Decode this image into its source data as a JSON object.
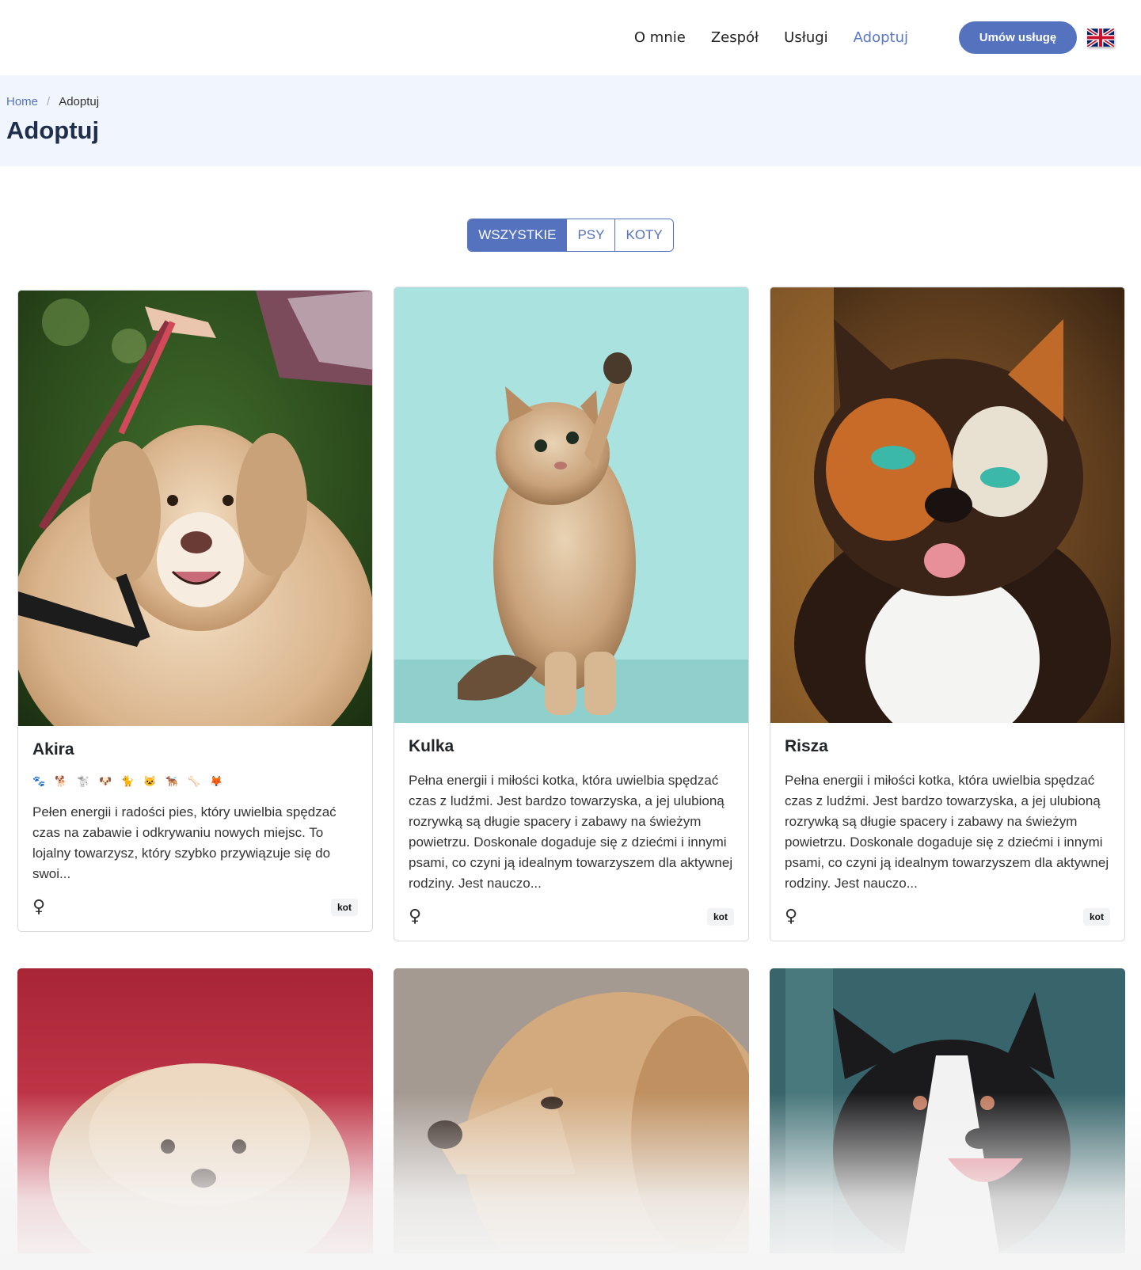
{
  "nav": {
    "links": [
      "O mnie",
      "Zespół",
      "Usługi",
      "Adoptuj"
    ],
    "active": "Adoptuj",
    "cta_label": "Umów usługę",
    "language_flag": "uk-flag-icon"
  },
  "breadcrumb": {
    "home": "Home",
    "separator": "/",
    "current": "Adoptuj"
  },
  "page_title": "Adoptuj",
  "filter": {
    "options": [
      "WSZYSTKIE",
      "PSY",
      "KOTY"
    ],
    "active": "WSZYSTKIE"
  },
  "cards": [
    {
      "name": "Akira",
      "emojis": [
        "🐾",
        "🐕",
        "🐩",
        "🐶",
        "🐈",
        "🐱",
        "🐕‍🦺",
        "🦴",
        "🦊"
      ],
      "description": "Pełen energii i radości pies, który uwielbia spędzać czas na zabawie i odkrywaniu nowych miejsc. To lojalny towarzysz, który szybko przywiązuje się do swoi...",
      "gender_icon": "♀",
      "tag": "kot",
      "image": "golden-retriever-on-leash"
    },
    {
      "name": "Kulka",
      "description": "Pełna energii i miłości kotka, która uwielbia spędzać czas z ludźmi. Jest bardzo towarzyska, a jej ulubioną rozrywką są długie spacery i zabawy na świeżym powietrzu. Doskonale dogaduje się z dziećmi i innymi psami, co czyni ją idealnym towarzyszem dla aktywnej rodziny. Jest nauczo...",
      "gender_icon": "♀",
      "tag": "kot",
      "image": "kitten-raising-paw"
    },
    {
      "name": "Risza",
      "description": "Pełna energii i miłości kotka, która uwielbia spędzać czas z ludźmi. Jest bardzo towarzyska, a jej ulubioną rozrywką są długie spacery i zabawy na świeżym powietrzu. Doskonale dogaduje się z dziećmi i innymi psami, co czyni ją idealnym towarzyszem dla aktywnej rodziny. Jest nauczo...",
      "gender_icon": "♀",
      "tag": "kot",
      "image": "calico-cat-tongue"
    }
  ],
  "bottom_cards": [
    "fluffy-dog-red-background",
    "golden-dog-profile",
    "border-collie-smiling"
  ],
  "colors": {
    "accent": "#5472bd",
    "header_bg": "#f1f5fd",
    "title": "#1f2f4b"
  }
}
